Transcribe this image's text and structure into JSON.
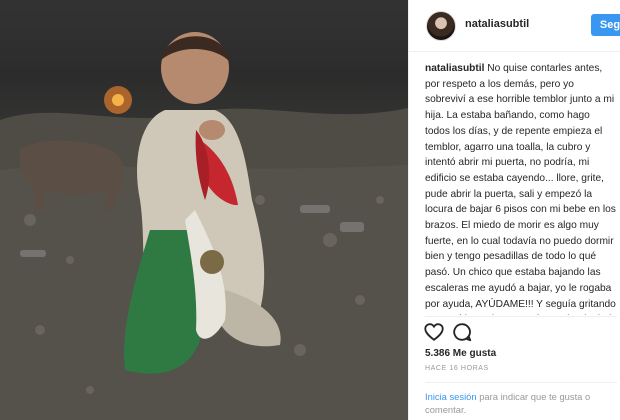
{
  "post": {
    "image_description_icon": "photo",
    "username": "nataliasubtil",
    "follow_label": "Seguir",
    "caption_username": "nataliasubtil",
    "caption_text": " No quise contarles antes, por respeto a los demás, pero yo sobreviví a ese horrible temblor junto a mi hija. La estaba bañando, como hago todos los días, y de repente empieza el temblor, agarro una toalla, la cubro y intentó abrir mi puerta, no podría, mi edificio se estaba cayendo... llore, grite, pude abrir la puerta, sali y empezó la locura de bajar 6 pisos con mi bebe en los brazos. El miedo de morir es algo muy fuerte, en lo cual todavía no puedo dormir bien y tengo pesadillas de todo lo qué pasó. Un chico que estaba bajando las escaleras me ayudó a bajar, yo le rogaba por ayuda, AYÚDAME!!! Y seguía gritando en su oído, y el me seguía ayudando, baje las escaleras cayendo, con mucho miedo, que algo pasara, todo mi edificio se estaba cayendo, baje, me senté en medio de la calle, miles de personas a",
    "likes": "5.386 Me gusta",
    "timestamp": "HACE 16 HORAS",
    "login_link": "Inicia sesión",
    "login_rest": " para indicar que te gusta o comentar."
  },
  "icons": {
    "like": "heart-icon",
    "comment": "comment-icon"
  },
  "colors": {
    "accent": "#3897f0",
    "text": "#262626",
    "muted": "#999999",
    "flag_green": "#2f7a43",
    "flag_red": "#c6262e"
  }
}
